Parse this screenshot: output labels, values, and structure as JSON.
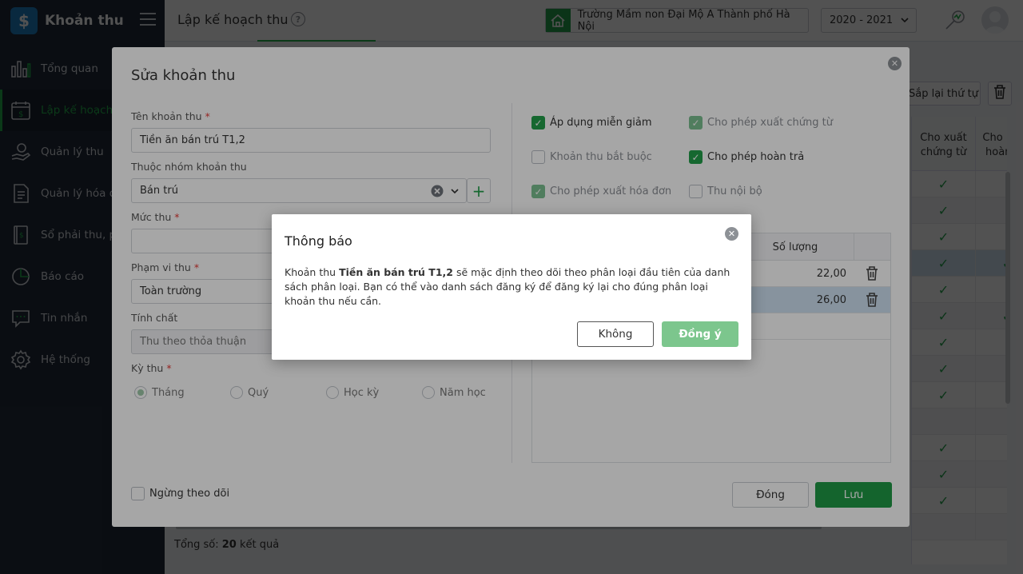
{
  "app": {
    "brand_symbol": "$",
    "brand_title": "Khoản thu"
  },
  "sidebar": {
    "items": [
      {
        "label": "Tổng quan",
        "icon": "bar-chart-icon",
        "active": false
      },
      {
        "label": "Lập kế hoạch thu",
        "icon": "calendar-money-icon",
        "active": true
      },
      {
        "label": "Quản lý thu",
        "icon": "hand-money-icon",
        "active": false
      },
      {
        "label": "Quản lý hóa đơn",
        "icon": "invoice-icon",
        "active": false
      },
      {
        "label": "Sổ phải thu, phải trả",
        "icon": "ledger-icon",
        "active": false
      },
      {
        "label": "Báo cáo",
        "icon": "pie-chart-icon",
        "active": false
      },
      {
        "label": "Tin nhắn",
        "icon": "message-icon",
        "active": false
      },
      {
        "label": "Hệ thống",
        "icon": "gear-icon",
        "active": false
      }
    ]
  },
  "header": {
    "title": "Lập kế hoạch thu",
    "help_symbol": "?",
    "school": "Trường Mầm non Đại Mộ A Thành phố Hà Nội",
    "year": "2020 - 2021"
  },
  "background": {
    "sort_button": "Sắp lại thứ tự",
    "col1": "Cho xuất chứng từ",
    "col2": "Cho phép hoàn trả",
    "check_symbol": "✓",
    "rows": [
      {
        "c1": true,
        "c2": false,
        "style": ""
      },
      {
        "c1": true,
        "c2": false,
        "style": "alt"
      },
      {
        "c1": true,
        "c2": false,
        "style": ""
      },
      {
        "c1": true,
        "c2": true,
        "style": "sel"
      },
      {
        "c1": true,
        "c2": false,
        "style": ""
      },
      {
        "c1": true,
        "c2": true,
        "style": "alt"
      },
      {
        "c1": true,
        "c2": false,
        "style": ""
      },
      {
        "c1": true,
        "c2": false,
        "style": "alt"
      },
      {
        "c1": true,
        "c2": false,
        "style": ""
      },
      {
        "c1": false,
        "c2": false,
        "style": "alt"
      },
      {
        "c1": true,
        "c2": false,
        "style": ""
      },
      {
        "c1": true,
        "c2": false,
        "style": "alt"
      },
      {
        "c1": true,
        "c2": false,
        "style": ""
      },
      {
        "c1": false,
        "c2": false,
        "style": "alt"
      }
    ],
    "total_label": "Tổng số:",
    "total_count": "20",
    "total_suffix": "kết quả"
  },
  "edit_modal": {
    "title": "Sửa khoản thu",
    "close_symbol": "✕",
    "required_mark": "*",
    "name_label": "Tên khoản thu",
    "name_value": "Tiền ăn bán trú T1,2",
    "group_label": "Thuộc nhóm khoản thu",
    "group_value": "Bán trú",
    "add_symbol": "+",
    "rate_label": "Mức thu",
    "rate_value": "",
    "scope_label": "Phạm vi thu",
    "scope_value": "Toàn trường",
    "nature_label": "Tính chất",
    "nature_value": "Thu theo thỏa thuận",
    "period_label": "Kỳ thu",
    "periods": [
      {
        "label": "Tháng",
        "selected": true
      },
      {
        "label": "Quý",
        "selected": false
      },
      {
        "label": "Học kỳ",
        "selected": false
      },
      {
        "label": "Năm học",
        "selected": false
      }
    ],
    "options": [
      {
        "label": "Áp dụng miễn giảm",
        "checked": true,
        "dim": false,
        "muted": false
      },
      {
        "label": "Cho phép xuất chứng từ",
        "checked": true,
        "dim": true,
        "muted": true
      },
      {
        "label": "Khoản thu bắt buộc",
        "checked": false,
        "dim": false,
        "muted": true
      },
      {
        "label": "Cho phép hoàn trả",
        "checked": true,
        "dim": false,
        "muted": false
      },
      {
        "label": "Cho phép xuất hóa đơn",
        "checked": true,
        "dim": true,
        "muted": true
      },
      {
        "label": "Thu nội bộ",
        "checked": false,
        "dim": false,
        "muted": true
      }
    ],
    "table_qty_header": "Số lượng",
    "table_rows": [
      {
        "qty": "22,00",
        "selected": false
      },
      {
        "qty": "26,00",
        "selected": true
      }
    ],
    "stop_tracking_label": "Ngừng theo dõi",
    "close_button": "Đóng",
    "save_button": "Lưu"
  },
  "notice": {
    "title": "Thông báo",
    "close_symbol": "✕",
    "body_prefix": "Khoản thu",
    "body_item": "Tiền ăn bán trú T1,2",
    "body_suffix": "sẽ mặc định theo dõi theo phân loại đầu tiên của danh sách phân loại. Bạn có thể vào danh sách đăng ký để đăng ký lại cho đúng phân loại khoản thu nếu cần.",
    "no_button": "Không",
    "yes_button": "Đồng ý"
  },
  "colors": {
    "accent": "#22b14c",
    "sidebar_bg": "#212b3b",
    "primary_button": "#1f9a45"
  }
}
